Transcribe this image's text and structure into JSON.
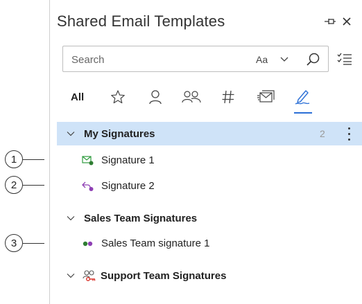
{
  "header": {
    "title": "Shared Email Templates",
    "pin_icon": "pin-icon",
    "close_glyph": "✕"
  },
  "search": {
    "placeholder": "Search",
    "match_case_label": "Aa",
    "search_icon": "search-icon",
    "options_icon": "checklist-icon"
  },
  "tabs": [
    {
      "id": "all",
      "label": "All"
    },
    {
      "id": "favorites",
      "icon": "star-icon"
    },
    {
      "id": "my",
      "icon": "person-icon"
    },
    {
      "id": "team",
      "icon": "people-icon"
    },
    {
      "id": "macros",
      "icon": "hashtag-icon"
    },
    {
      "id": "templates",
      "icon": "template-icon"
    },
    {
      "id": "signatures",
      "icon": "signature-icon",
      "active": true
    }
  ],
  "groups": [
    {
      "label": "My Signatures",
      "count": "2",
      "selected": true,
      "items": [
        {
          "label": "Signature 1",
          "icon": "email-signature-icon"
        },
        {
          "label": "Signature 2",
          "icon": "reply-signature-icon"
        }
      ]
    },
    {
      "label": "Sales Team Signatures",
      "items": [
        {
          "label": "Sales Team signature 1",
          "icon": "team-dots-icon"
        }
      ]
    },
    {
      "label": "Support Team Signatures",
      "icon": "shared-team-key-icon",
      "items": []
    }
  ],
  "callouts": [
    "1",
    "2",
    "3"
  ],
  "colors": {
    "accent": "#2b6fd6",
    "selected_row": "#cfe3f8",
    "green": "#2e9b3e",
    "purple": "#8e3fb4",
    "red": "#d9342b"
  }
}
